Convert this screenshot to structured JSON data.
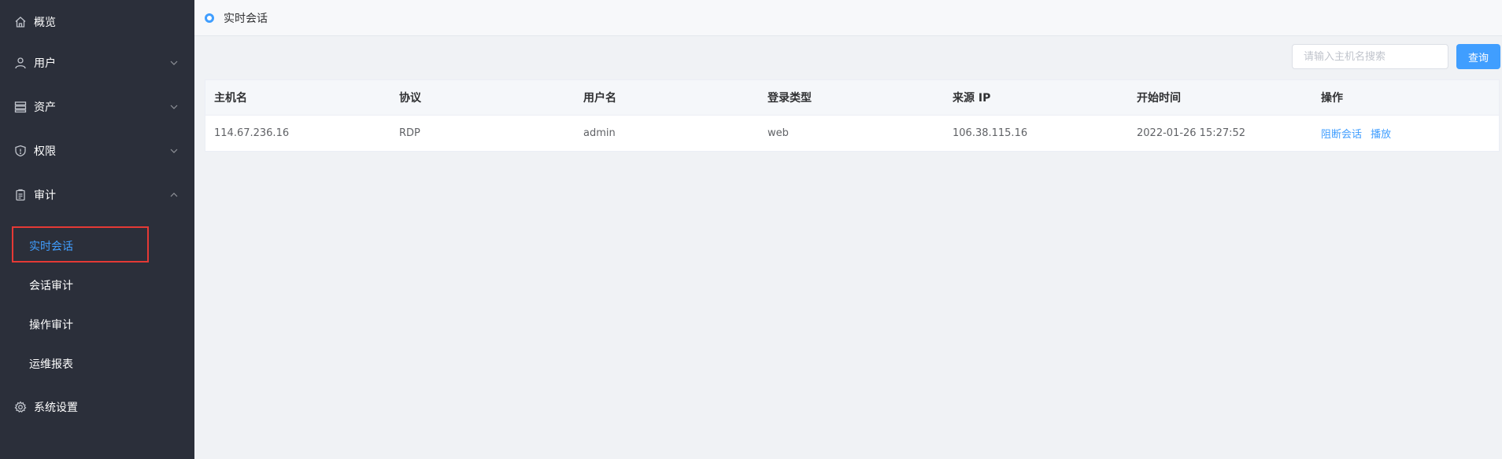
{
  "sidebar": {
    "items": [
      {
        "label": "概览",
        "icon": "home-icon",
        "has_arrow": false
      },
      {
        "label": "用户",
        "icon": "user-icon",
        "has_arrow": true,
        "expanded": false
      },
      {
        "label": "资产",
        "icon": "server-icon",
        "has_arrow": true,
        "expanded": false
      },
      {
        "label": "权限",
        "icon": "shield-icon",
        "has_arrow": true,
        "expanded": false
      },
      {
        "label": "审计",
        "icon": "clipboard-icon",
        "has_arrow": true,
        "expanded": true
      },
      {
        "label": "系统设置",
        "icon": "gear-icon",
        "has_arrow": false
      }
    ],
    "audit_sub_items": [
      {
        "label": "实时会话",
        "active": true
      },
      {
        "label": "会话审计",
        "active": false
      },
      {
        "label": "操作审计",
        "active": false
      },
      {
        "label": "运维报表",
        "active": false
      }
    ]
  },
  "header": {
    "tab_label": "实时会话"
  },
  "search": {
    "placeholder": "请输入主机名搜索",
    "value": "",
    "button_label": "查询"
  },
  "table": {
    "columns": [
      "主机名",
      "协议",
      "用户名",
      "登录类型",
      "来源 IP",
      "开始时间",
      "操作"
    ],
    "rows": [
      {
        "hostname": "114.67.236.16",
        "protocol": "RDP",
        "username": "admin",
        "login_type": "web",
        "source_ip": "106.38.115.16",
        "start_time": "2022-01-26 15:27:52",
        "actions": [
          "阻断会话",
          "播放"
        ]
      }
    ]
  },
  "colors": {
    "sidebar_bg": "#2b2f3a",
    "accent": "#409eff",
    "highlight_border": "#e53935",
    "page_bg": "#f0f2f5"
  }
}
